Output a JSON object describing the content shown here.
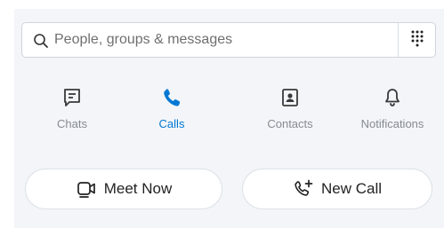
{
  "search": {
    "placeholder": "People, groups & messages",
    "value": "",
    "search_icon": "search-icon",
    "dialpad_icon": "dialpad-icon"
  },
  "tabs": [
    {
      "label": "Chats",
      "icon": "chat-icon",
      "active": false
    },
    {
      "label": "Calls",
      "icon": "phone-icon",
      "active": true
    },
    {
      "label": "Contacts",
      "icon": "contact-card-icon",
      "active": false
    },
    {
      "label": "Notifications",
      "icon": "bell-icon",
      "active": false
    }
  ],
  "actions": {
    "meet_now_label": "Meet Now",
    "meet_now_icon": "video-camera-icon",
    "new_call_label": "New Call",
    "new_call_icon": "add-call-icon"
  },
  "colors": {
    "accent": "#0078d4",
    "inactive": "#868b93",
    "panel_bg": "#f3f5f8"
  }
}
